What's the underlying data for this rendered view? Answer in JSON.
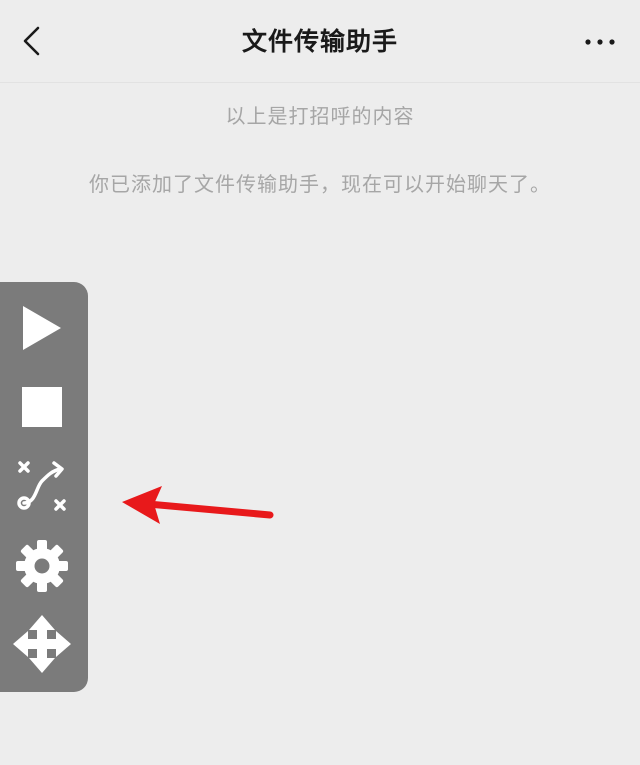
{
  "header": {
    "title": "文件传输助手",
    "back_icon": "chevron-left-icon",
    "more_icon": "more-horizontal-icon"
  },
  "messages": [
    "以上是打招呼的内容",
    "你已添加了文件传输助手，现在可以开始聊天了。"
  ],
  "toolbar": {
    "items": [
      {
        "icon": "play-icon"
      },
      {
        "icon": "stop-icon"
      },
      {
        "icon": "path-route-icon"
      },
      {
        "icon": "gear-icon"
      },
      {
        "icon": "move-icon"
      }
    ]
  },
  "annotation": {
    "icon": "red-arrow-icon",
    "color": "#e8191b"
  },
  "colors": {
    "background": "#ededed",
    "toolbar": "#7b7b7b",
    "text_primary": "#1a1a1a",
    "text_secondary": "#a6a6a6",
    "icon_white": "#ffffff"
  }
}
